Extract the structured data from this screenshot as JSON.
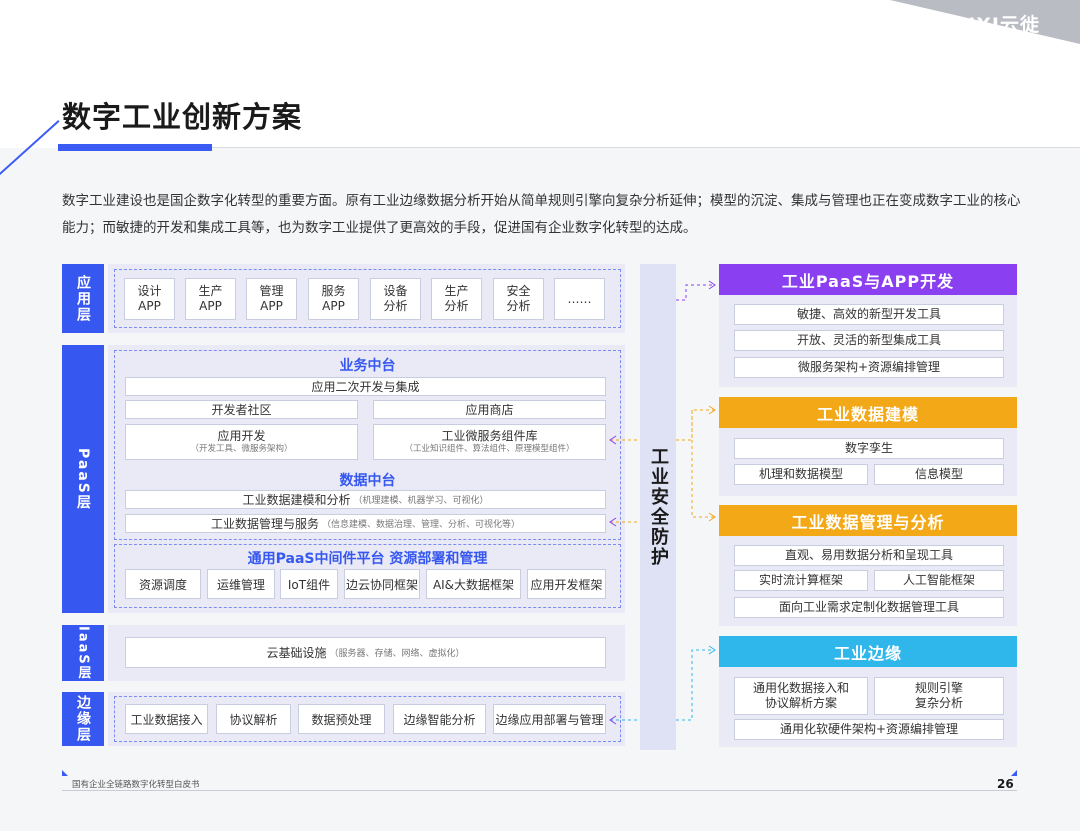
{
  "brand": {
    "logo": "YUNXI云徙",
    "accent": "#3657f0"
  },
  "title": "数字工业创新方案",
  "intro": "数字工业建设也是国企数字化转型的重要方面。原有工业边缘数据分析开始从简单规则引擎向复杂分析延伸；模型的沉淀、集成与管理也正在变成数字工业的核心能力；而敏捷的开发和集成工具等，也为数字工业提供了更高效的手段，促进国有企业数字化转型的达成。",
  "layers": {
    "app": "应用层",
    "paas": "PaaS层",
    "iaas": "IaaS层",
    "edge": "边缘层"
  },
  "app_items": [
    {
      "l1": "设计",
      "l2": "APP"
    },
    {
      "l1": "生产",
      "l2": "APP"
    },
    {
      "l1": "管理",
      "l2": "APP"
    },
    {
      "l1": "服务",
      "l2": "APP"
    },
    {
      "l1": "设备",
      "l2": "分析"
    },
    {
      "l1": "生产",
      "l2": "分析"
    },
    {
      "l1": "安全",
      "l2": "分析"
    },
    {
      "l1": "……",
      "l2": ""
    }
  ],
  "paas": {
    "business_title": "业务中台",
    "app_dev_integration": "应用二次开发与集成",
    "dev_community": "开发者社区",
    "app_store": "应用商店",
    "app_dev": "应用开发",
    "app_dev_sub": "（开发工具、微服务架构）",
    "micro_lib": "工业微服务组件库",
    "micro_lib_sub": "（工业知识组件、算法组件、原理模型组件）",
    "data_title": "数据中台",
    "data_model": "工业数据建模和分析",
    "data_model_sub": "（机理建模、机器学习、可视化）",
    "data_mgmt": "工业数据管理与服务",
    "data_mgmt_sub": "（信息建模、数据治理、管理、分析、可视化等）",
    "middleware_title": "通用PaaS中间件平台 资源部署和管理",
    "middleware_items": [
      "资源调度",
      "运维管理",
      "IoT组件",
      "边云协同框架",
      "AI&大数据框架",
      "应用开发框架"
    ]
  },
  "iaas": {
    "cloud": "云基础设施",
    "cloud_sub": "（服务器、存储、网络、虚拟化）"
  },
  "edge_items": [
    "工业数据接入",
    "协议解析",
    "数据预处理",
    "边缘智能分析",
    "边缘应用部署与管理"
  ],
  "security": "工业安全防护",
  "right": {
    "p1": {
      "title": "工业PaaS与APP开发",
      "color": "#8a3ff0",
      "items": [
        "敏捷、高效的新型开发工具",
        "开放、灵活的新型集成工具",
        "微服务架构+资源编排管理"
      ]
    },
    "p2": {
      "title": "工业数据建模",
      "color": "#f3a817",
      "items": [
        "数字孪生",
        "机理和数据模型",
        "信息模型"
      ]
    },
    "p3": {
      "title": "工业数据管理与分析",
      "color": "#f3a817",
      "items": [
        "直观、易用数据分析和呈现工具",
        "实时流计算框架",
        "人工智能框架",
        "面向工业需求定制化数据管理工具"
      ]
    },
    "p4": {
      "title": "工业边缘",
      "color": "#2fb6ea",
      "items": [
        "通用化数据接入和",
        "协议解析方案",
        "规则引擎",
        "复杂分析",
        "通用化软硬件架构+资源编排管理"
      ]
    }
  },
  "footer": {
    "doc": "国有企业全链路数字化转型白皮书",
    "page": "26"
  }
}
